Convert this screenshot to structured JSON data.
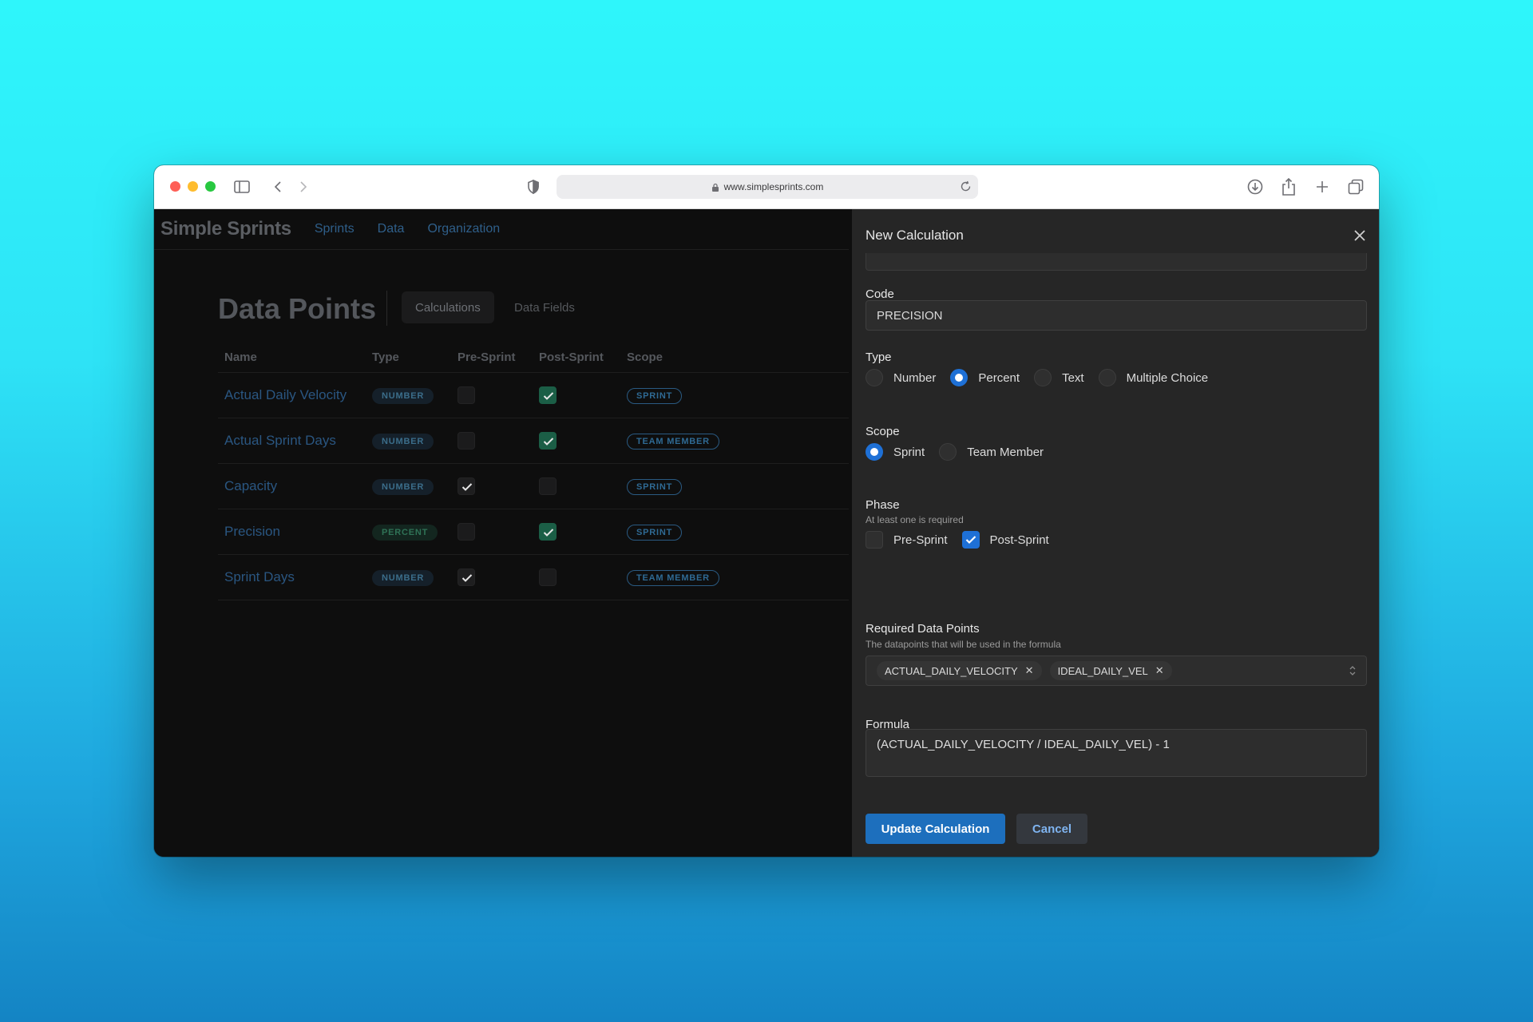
{
  "browser": {
    "url": "www.simplesprints.com",
    "icons": [
      "sidebar-icon",
      "back-icon",
      "forward-icon",
      "shield-icon",
      "lock-icon",
      "reload-icon",
      "download-icon",
      "share-icon",
      "new-tab-icon",
      "tabs-overview-icon"
    ]
  },
  "nav": {
    "brand": "Simple Sprints",
    "links": [
      "Sprints",
      "Data",
      "Organization"
    ]
  },
  "page": {
    "title": "Data Points",
    "tabs": [
      "Calculations",
      "Data Fields"
    ],
    "active_tab": "Calculations"
  },
  "table": {
    "headers": [
      "Name",
      "Type",
      "Pre-Sprint",
      "Post-Sprint",
      "Scope"
    ],
    "rows": [
      {
        "name": "Actual Daily Velocity",
        "type": "NUMBER",
        "pre": false,
        "post": true,
        "scope": "SPRINT"
      },
      {
        "name": "Actual Sprint Days",
        "type": "NUMBER",
        "pre": false,
        "post": true,
        "scope": "TEAM MEMBER"
      },
      {
        "name": "Capacity",
        "type": "NUMBER",
        "pre": true,
        "post": false,
        "scope": "SPRINT"
      },
      {
        "name": "Precision",
        "type": "PERCENT",
        "pre": false,
        "post": true,
        "scope": "SPRINT"
      },
      {
        "name": "Sprint Days",
        "type": "NUMBER",
        "pre": true,
        "post": false,
        "scope": "TEAM MEMBER"
      }
    ]
  },
  "drawer": {
    "title": "New Calculation",
    "code": {
      "label": "Code",
      "value": "PRECISION"
    },
    "type": {
      "label": "Type",
      "options": [
        "Number",
        "Percent",
        "Text",
        "Multiple Choice"
      ],
      "selected": "Percent"
    },
    "scope": {
      "label": "Scope",
      "options": [
        "Sprint",
        "Team Member"
      ],
      "selected": "Sprint"
    },
    "phase": {
      "label": "Phase",
      "hint": "At least one is required",
      "options": [
        "Pre-Sprint",
        "Post-Sprint"
      ],
      "checked": [
        false,
        true
      ]
    },
    "required": {
      "label": "Required Data Points",
      "hint": "The datapoints that will be used in the formula",
      "chips": [
        "ACTUAL_DAILY_VELOCITY",
        "IDEAL_DAILY_VEL"
      ]
    },
    "formula": {
      "label": "Formula",
      "value": "(ACTUAL_DAILY_VELOCITY / IDEAL_DAILY_VEL) - 1"
    },
    "buttons": {
      "submit": "Update Calculation",
      "cancel": "Cancel"
    }
  },
  "colors": {
    "accent": "#1e70d6",
    "primary_button": "#1d6fbd",
    "link": "#2a5681",
    "success": "#1b5e46"
  }
}
